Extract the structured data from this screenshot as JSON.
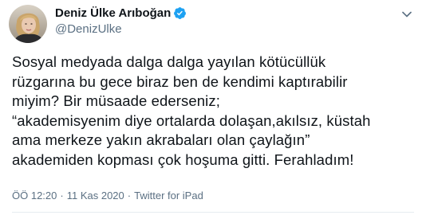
{
  "author": {
    "display_name": "Deniz Ülke Arıboğan",
    "handle": "@DenizUlke",
    "verified": true
  },
  "tweet": {
    "lines": [
      "Sosyal medyada dalga dalga yayılan kötücüllük",
      "rüzgarına bu gece biraz ben de kendimi kaptırabilir",
      "miyim? Bir müsaade ederseniz;",
      "“akademisyenim diye ortalarda dolaşan,akılsız, küstah",
      "ama merkeze yakın akrabaları olan çaylağın”",
      "akademiden kopması çok hoşuma gitti. Ferahladım!"
    ]
  },
  "meta": {
    "time": "ÖÖ 12:20",
    "separator": "·",
    "date": "11 Kas 2020",
    "source": "Twitter for iPad"
  },
  "icons": {
    "verified": "verified-badge-icon",
    "more": "chevron-down-icon"
  },
  "colors": {
    "verified_blue": "#1da1f2",
    "secondary_text": "#5b7083",
    "primary_text": "#0f1419"
  }
}
